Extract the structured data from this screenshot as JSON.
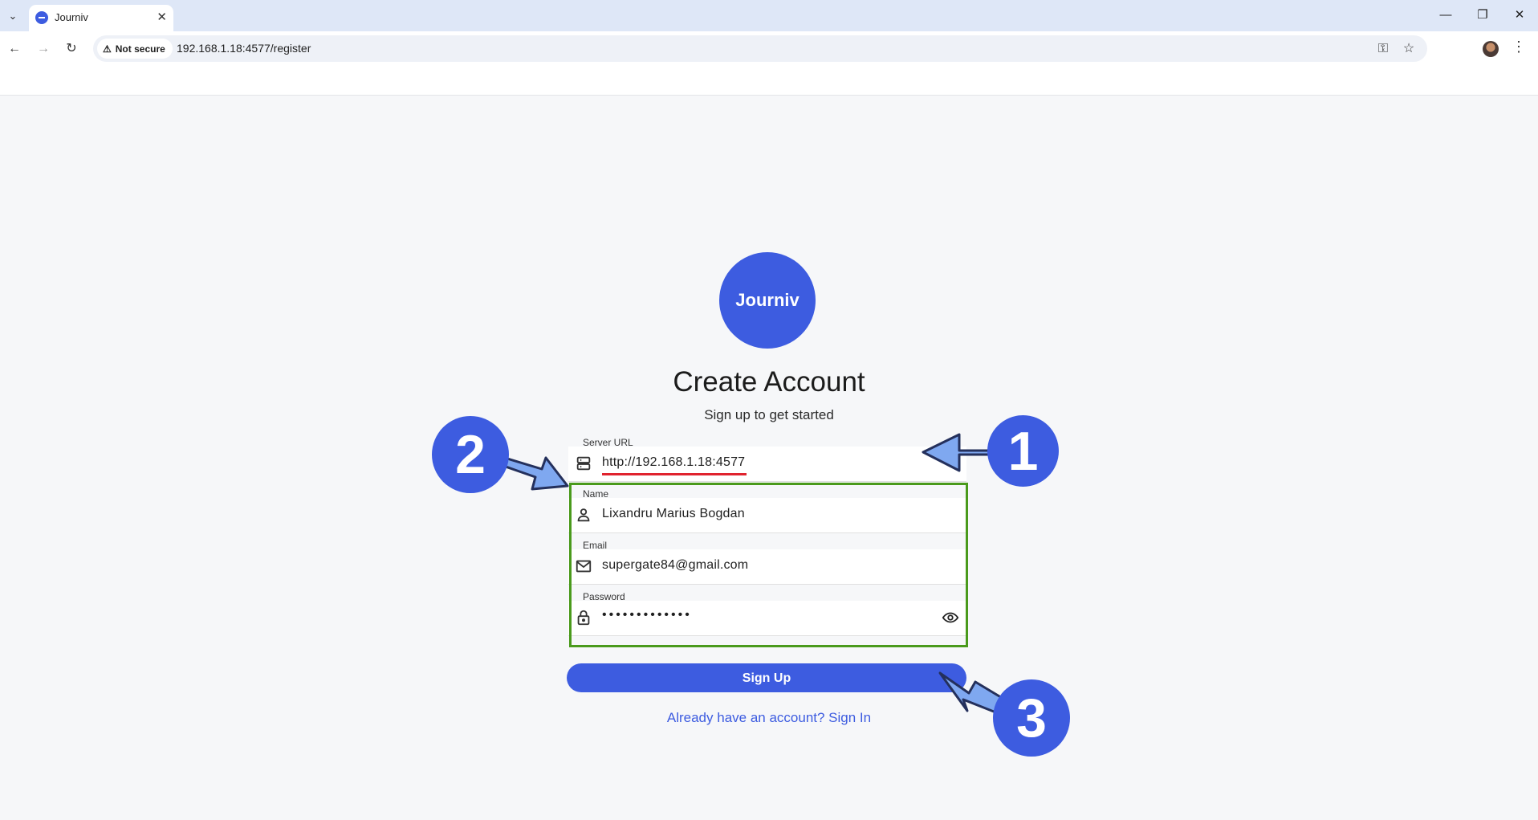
{
  "browser": {
    "tab_title": "Journiv",
    "security_label": "Not secure",
    "url": "192.168.1.18:4577/register"
  },
  "page": {
    "logo_text": "Journiv",
    "title": "Create Account",
    "subtitle": "Sign up to get started"
  },
  "form": {
    "server_url": {
      "label": "Server URL",
      "value": "http://192.168.1.18:4577",
      "icon": "server-icon"
    },
    "name": {
      "label": "Name",
      "value": "Lixandru Marius Bogdan",
      "icon": "person-icon"
    },
    "email": {
      "label": "Email",
      "value": "supergate84@gmail.com",
      "icon": "mail-icon"
    },
    "password": {
      "label": "Password",
      "value": "•••••••••••••",
      "icon": "lock-icon"
    },
    "submit_label": "Sign Up",
    "signin_link": "Already have an account? Sign In"
  },
  "annotations": {
    "badge_1": "1",
    "badge_2": "2",
    "badge_3": "3",
    "accent_color": "#3d5ce0",
    "arrow_color": "#7fa8f0",
    "highlight_color": "#4a9a1c",
    "underline_color": "#e0232e"
  }
}
